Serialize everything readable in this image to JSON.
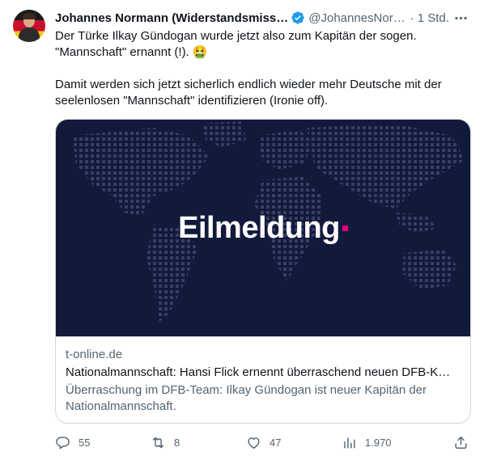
{
  "author": {
    "name": "Johannes Normann (Widerstandsmiss…",
    "handle": "@JohannesNor…",
    "separator": "·",
    "time": "1 Std."
  },
  "tweet": {
    "line1": "Der Türke Ilkay Gündogan wurde jetzt also zum Kapitän der sogen.",
    "line2": "\"Mannschaft\" ernannt (!). 🤮",
    "line3": "Damit werden sich jetzt sicherlich endlich wieder mehr Deutsche mit der seelenlosen \"Mannschaft\" identifizieren (Ironie off)."
  },
  "card": {
    "image_headline": "Eilmeldung",
    "domain": "t-online.de",
    "title": "Nationalmannschaft: Hansi Flick ernennt überraschend neuen DFB-K…",
    "description": "Überraschung im DFB-Team: Ilkay Gündogan ist neuer Kapitän der Nationalmannschaft."
  },
  "actions": {
    "replies": "55",
    "reposts": "8",
    "likes": "47",
    "views": "1.970"
  },
  "colors": {
    "verified_blue": "#1d9bf0",
    "card_bg": "#121a3b",
    "accent_magenta": "#e6007e",
    "muted": "#536471"
  }
}
